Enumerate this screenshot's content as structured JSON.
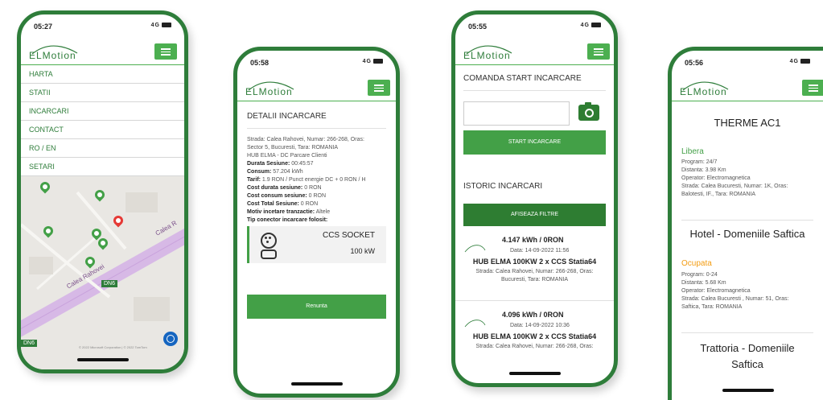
{
  "brand": {
    "logo_text": "ELMotion",
    "accent": "#2e7d3a",
    "button_green": "#43a047"
  },
  "phone1": {
    "time": "05:27",
    "signal": "4G",
    "nav": [
      "HARTA",
      "STATII",
      "INCARCARI",
      "CONTACT",
      "RO / EN",
      "SETARI"
    ],
    "map_labels": {
      "road1": "Calea Rahovei",
      "road2": "Calea R",
      "badge1": "DN6",
      "badge2": "DN6"
    },
    "attribution": "© 2022 Microsoft Corporation | © 2022 TomTom",
    "locate_icon": "crosshair-icon"
  },
  "phone2": {
    "time": "05:58",
    "signal": "4G",
    "title": "DETALII INCARCARE",
    "address_lines": [
      "Strada: Calea Rahovei, Numar: 266-268, Oras:",
      "Sector 5, Bucuresti, Tara: ROMANIA",
      "HUB ELMA - DC Parcare Clienti"
    ],
    "details": [
      {
        "label": "Durata Sesiune:",
        "value": " 00:45:57"
      },
      {
        "label": "Consum:",
        "value": " 57.204 kWh"
      },
      {
        "label": "Tarif:",
        "value": " 1.9 RON / Punct energie DC + 0 RON / H"
      },
      {
        "label": "Cost durata sesiune:",
        "value": " 0 RON"
      },
      {
        "label": "Cost consum sesiune:",
        "value": " 0 RON"
      },
      {
        "label": "Cost Total Sesiune:",
        "value": " 0 RON"
      },
      {
        "label": "Motiv incetare tranzactie:",
        "value": " Altele"
      },
      {
        "label": "Tip conector incarcare folosit:",
        "value": ""
      }
    ],
    "connector": {
      "name": "CCS SOCKET",
      "power": "100 kW",
      "icon": "ccs-plug-icon"
    },
    "cancel_label": "Renunta"
  },
  "phone3": {
    "time": "05:55",
    "signal": "4G",
    "title": "COMANDA START INCARCARE",
    "code_input_value": "",
    "camera_icon": "camera-icon",
    "start_label": "START INCARCARE",
    "history_title": "ISTORIC INCARCARI",
    "filter_label": "AFISEAZA FILTRE",
    "items": [
      {
        "kwh": "4.147 kWh / 0RON",
        "date": "Data: 14-09-2022 11:56",
        "hub": "HUB ELMA 100KW 2 x CCS Statia64",
        "addr1": "Strada: Calea Rahovei, Numar: 266-268, Oras:",
        "addr2": "Bucuresti, Tara: ROMANIA"
      },
      {
        "kwh": "4.096 kWh / 0RON",
        "date": "Data: 14-09-2022 10:36",
        "hub": "HUB ELMA 100KW 2 x CCS Statia64",
        "addr1": "Strada: Calea Rahovei, Numar: 266-268, Oras:",
        "addr2": ""
      }
    ]
  },
  "phone4": {
    "time": "05:56",
    "signal": "4G",
    "stations": [
      {
        "name": "THERME AC1",
        "status": "Libera",
        "status_color": "#43a047",
        "lines": [
          "Program: 24/7",
          "Distanta: 3.98 Km",
          "Operator: Electromagnetica",
          "Strada: Calea Bucuresti, Numar: 1K, Oras:",
          "Balotesti, IF., Tara: ROMANIA"
        ]
      },
      {
        "name": "Hotel - Domeniile Saftica",
        "status": "Ocupata",
        "status_color": "#f39c12",
        "lines": [
          "Program: 0-24",
          "Distanta: 5.68 Km",
          "Operator: Electromagnetica",
          "Strada: Calea Bucuresti , Numar: 51, Oras:",
          "Saftica, Tara: ROMANIA"
        ]
      },
      {
        "name": "Trattoria - Domeniile",
        "name2": "Saftica"
      }
    ]
  }
}
